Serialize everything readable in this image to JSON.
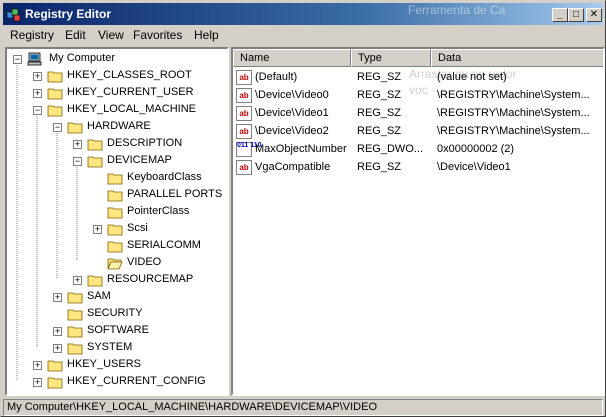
{
  "window": {
    "title": "Registry Editor",
    "background_ghost_text": "Ferramenta de Ca",
    "minimize_glyph": "_",
    "maximize_glyph": "□",
    "close_glyph": "✕"
  },
  "menu": [
    {
      "label": "Registry"
    },
    {
      "label": "Edit"
    },
    {
      "label": "View"
    },
    {
      "label": "Favorites"
    },
    {
      "label": "Help"
    }
  ],
  "tree": [
    {
      "label": "My Computer",
      "expander": "−",
      "icon": "computer-icon"
    },
    {
      "label": "HKEY_CLASSES_ROOT",
      "expander": "+",
      "icon": "folder-icon"
    },
    {
      "label": "HKEY_CURRENT_USER",
      "expander": "+",
      "icon": "folder-icon"
    },
    {
      "label": "HKEY_LOCAL_MACHINE",
      "expander": "−",
      "icon": "folder-icon"
    },
    {
      "label": "HARDWARE",
      "expander": "−",
      "icon": "folder-icon"
    },
    {
      "label": "DESCRIPTION",
      "expander": "+",
      "icon": "folder-icon"
    },
    {
      "label": "DEVICEMAP",
      "expander": "−",
      "icon": "folder-icon"
    },
    {
      "label": "KeyboardClass",
      "expander": "",
      "icon": "folder-icon"
    },
    {
      "label": "PARALLEL PORTS",
      "expander": "",
      "icon": "folder-icon"
    },
    {
      "label": "PointerClass",
      "expander": "",
      "icon": "folder-icon"
    },
    {
      "label": "Scsi",
      "expander": "+",
      "icon": "folder-icon"
    },
    {
      "label": "SERIALCOMM",
      "expander": "",
      "icon": "folder-icon"
    },
    {
      "label": "VIDEO",
      "expander": "",
      "icon": "open-folder-icon"
    },
    {
      "label": "RESOURCEMAP",
      "expander": "+",
      "icon": "folder-icon"
    },
    {
      "label": "SAM",
      "expander": "+",
      "icon": "folder-icon"
    },
    {
      "label": "SECURITY",
      "expander": "",
      "icon": "folder-icon"
    },
    {
      "label": "SOFTWARE",
      "expander": "+",
      "icon": "folder-icon"
    },
    {
      "label": "SYSTEM",
      "expander": "+",
      "icon": "folder-icon"
    },
    {
      "label": "HKEY_USERS",
      "expander": "+",
      "icon": "folder-icon"
    },
    {
      "label": "HKEY_CURRENT_CONFIG",
      "expander": "+",
      "icon": "folder-icon"
    }
  ],
  "list": {
    "columns": [
      "Name",
      "Type",
      "Data"
    ],
    "rows": [
      {
        "icon": "string-value-icon",
        "icon_text": "ab",
        "name": "(Default)",
        "type": "REG_SZ",
        "data": "(value not set)"
      },
      {
        "icon": "string-value-icon",
        "icon_text": "ab",
        "name": "\\Device\\Video0",
        "type": "REG_SZ",
        "data": "\\REGISTRY\\Machine\\System..."
      },
      {
        "icon": "string-value-icon",
        "icon_text": "ab",
        "name": "\\Device\\Video1",
        "type": "REG_SZ",
        "data": "\\REGISTRY\\Machine\\System..."
      },
      {
        "icon": "string-value-icon",
        "icon_text": "ab",
        "name": "\\Device\\Video2",
        "type": "REG_SZ",
        "data": "\\REGISTRY\\Machine\\System..."
      },
      {
        "icon": "binary-value-icon",
        "icon_text": "011 110",
        "name": "MaxObjectNumber",
        "type": "REG_DWO...",
        "data": "0x00000002 (2)"
      },
      {
        "icon": "string-value-icon",
        "icon_text": "ab",
        "name": "VgaCompatible",
        "type": "REG_SZ",
        "data": "\\Device\\Video1"
      }
    ],
    "ghost_text_1": "Arrastar ou ao redor",
    "ghost_text_2": "voc"
  },
  "status": {
    "path": "My Computer\\HKEY_LOCAL_MACHINE\\HARDWARE\\DEVICEMAP\\VIDEO"
  }
}
